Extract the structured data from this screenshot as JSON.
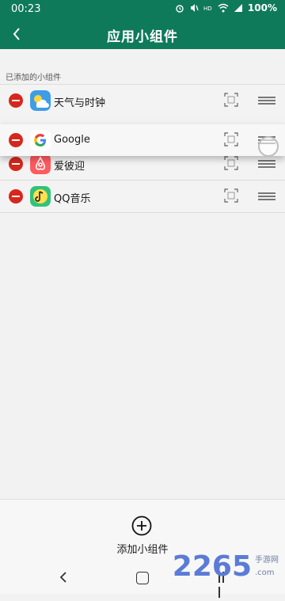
{
  "status_bar": {
    "time": "00:23",
    "icons": [
      "alarm-icon",
      "mute-icon",
      "hd-icon",
      "wifi-icon",
      "signal-icon"
    ],
    "battery": "100%"
  },
  "app_bar": {
    "title": "应用小组件"
  },
  "section_label": "已添加的小组件",
  "widgets": [
    {
      "name": "天气与时钟",
      "icon": "weather-icon"
    },
    {
      "name": "Google",
      "icon": "google-icon"
    },
    {
      "name": "爱彼迎",
      "icon": "airbnb-icon"
    },
    {
      "name": "QQ音乐",
      "icon": "qqmusic-icon"
    }
  ],
  "bottom": {
    "add_label": "添加小组件"
  },
  "watermark": {
    "number": "2265",
    "site": "手游网",
    "domain": ".com"
  },
  "colors": {
    "primary": "#0f7a5a",
    "remove": "#d6271c"
  }
}
